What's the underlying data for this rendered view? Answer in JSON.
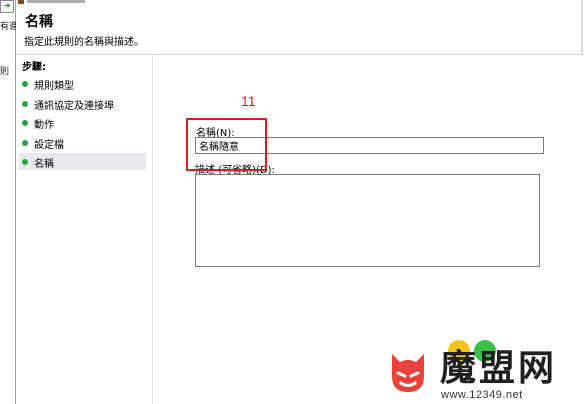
{
  "background_window": {
    "label_1": "有進",
    "label_2": "則"
  },
  "wizard": {
    "header": {
      "title": "名稱",
      "subtitle": "指定此規則的名稱與描述。"
    },
    "steps": {
      "label": "步驟:",
      "items": [
        {
          "label": "規則類型",
          "active": false
        },
        {
          "label": "通訊協定及連接埠",
          "active": false
        },
        {
          "label": "動作",
          "active": false
        },
        {
          "label": "設定檔",
          "active": false
        },
        {
          "label": "名稱",
          "active": true
        }
      ]
    },
    "form": {
      "name_label": "名稱(N):",
      "name_value": "名稱隨意",
      "description_label": "描述 (可省略)(D):",
      "description_value": ""
    },
    "back_button_label": "<"
  },
  "annotation": {
    "number": "11",
    "color": "#d32020"
  },
  "watermark": {
    "brand": "魔盟网",
    "url": "www.12349.net",
    "logo_color": "#e8423a"
  },
  "colors": {
    "step_dot": "#2ea043",
    "highlight": "#d81f1f"
  }
}
